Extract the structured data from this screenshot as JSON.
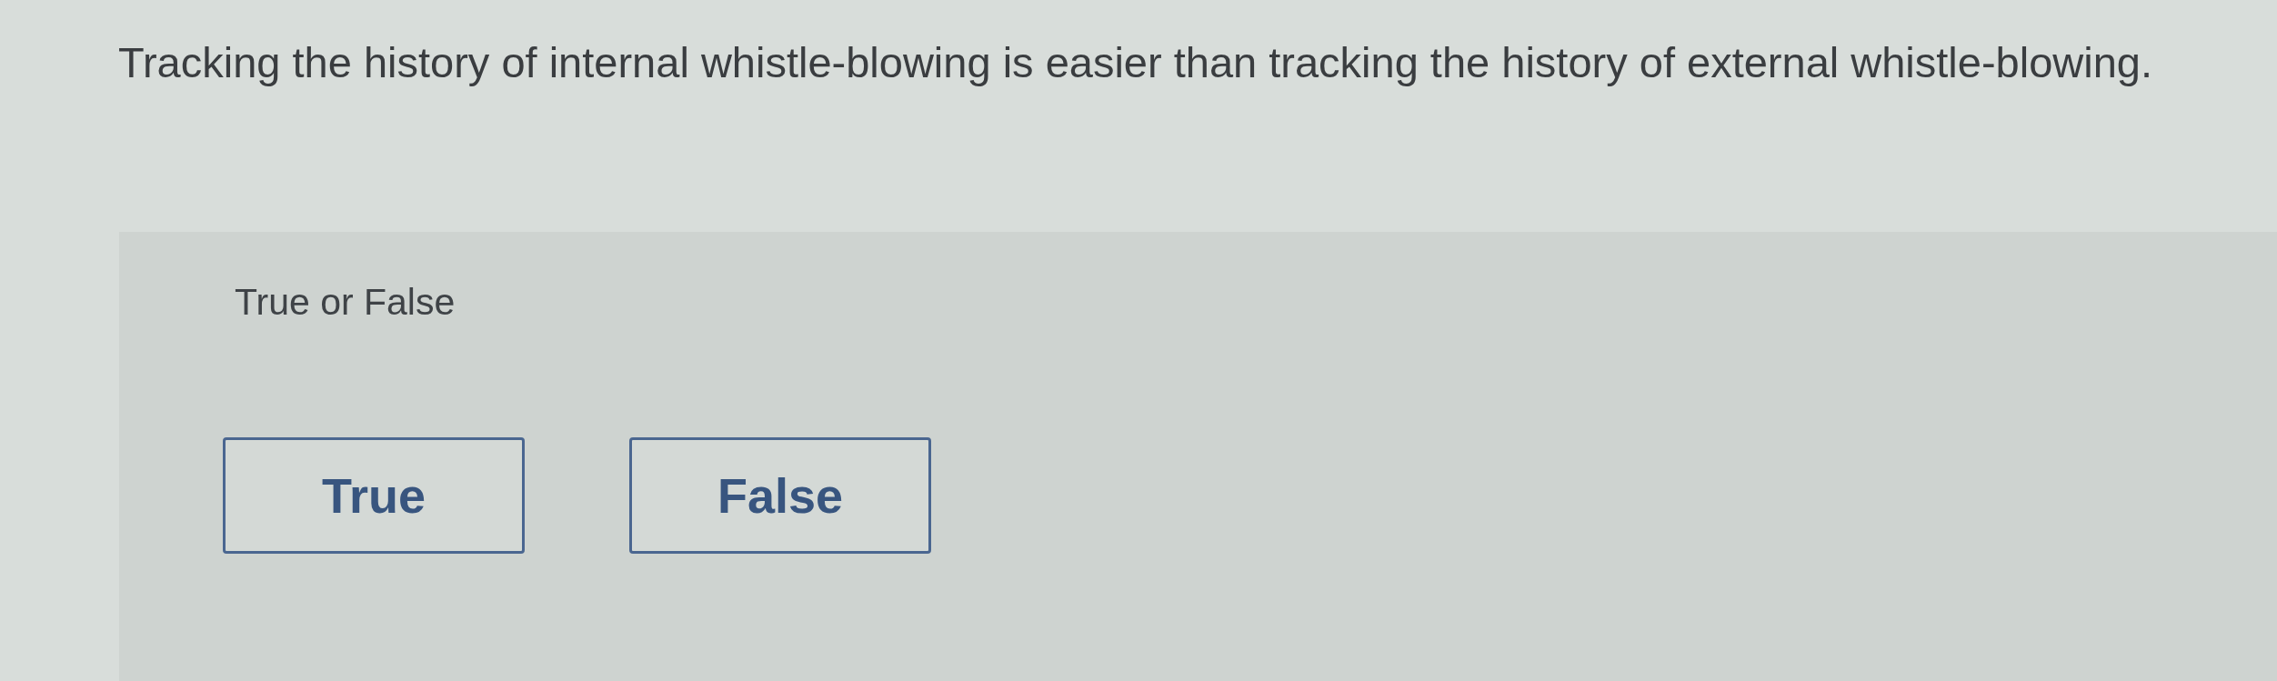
{
  "question": "Tracking the history of internal whistle-blowing is easier than tracking the history of external whistle-blowing.",
  "answer_panel": {
    "prompt": "True or False",
    "options": [
      {
        "label": "True",
        "selected": false
      },
      {
        "label": "False",
        "selected": false
      }
    ]
  }
}
